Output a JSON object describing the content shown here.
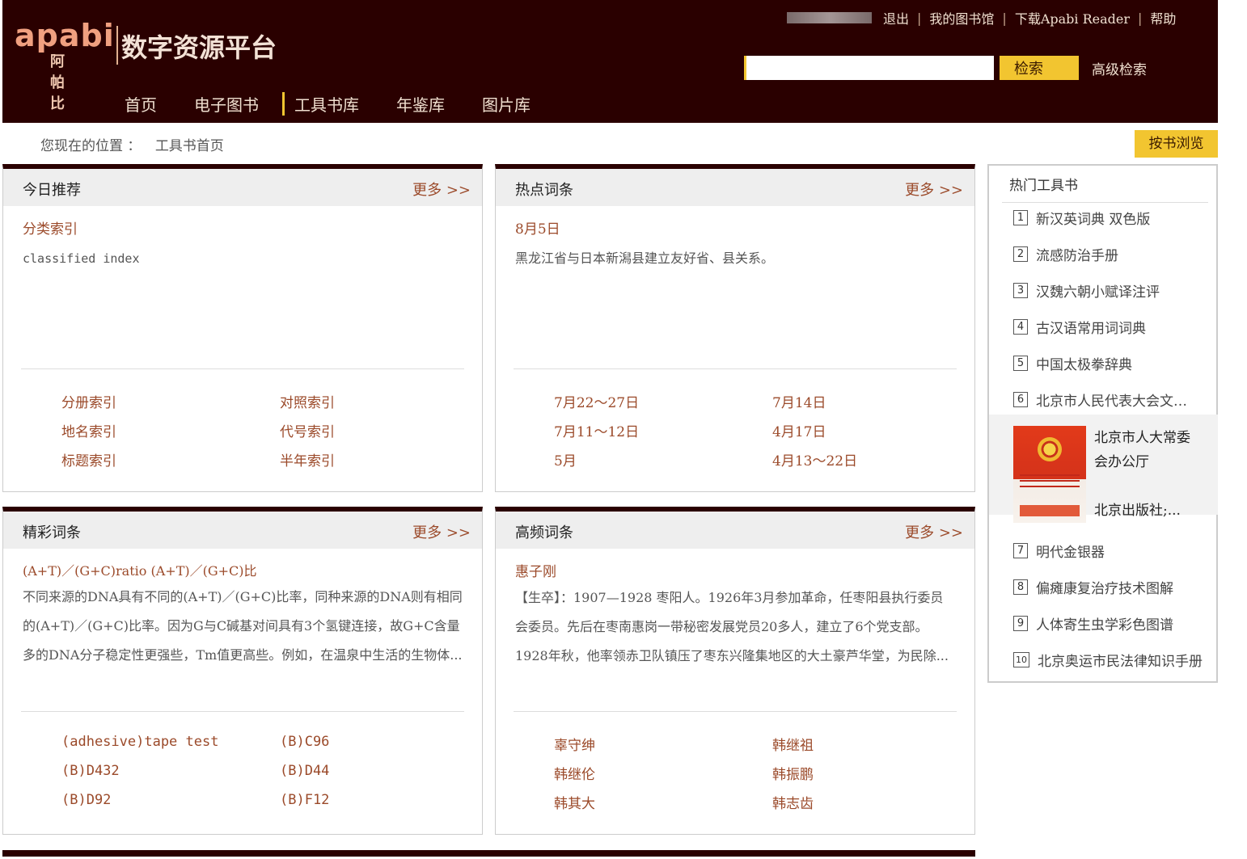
{
  "header": {
    "logo_en": "apabi",
    "logo_cn": "阿帕比",
    "platform_title": "数字资源平台",
    "links": [
      "退出",
      "我的图书馆",
      "下载Apabi Reader",
      "帮助"
    ],
    "search_placeholder": "",
    "search_button": "检索",
    "advanced_search": "高级检索",
    "nav": [
      {
        "label": "首页"
      },
      {
        "label": "电子图书"
      },
      {
        "label": "工具书库",
        "active": true
      },
      {
        "label": "年鉴库"
      },
      {
        "label": "图片库"
      }
    ]
  },
  "breadcrumb": {
    "prefix": "您现在的位置 ：",
    "current": "工具书首页"
  },
  "browse_button": "按书浏览",
  "panels": {
    "today": {
      "title": "今日推荐",
      "more": "更多 >>",
      "entry_title": "分类索引",
      "entry_text": "classified index",
      "links": [
        "分册索引",
        "对照索引",
        "地名索引",
        "代号索引",
        "标题索引",
        "半年索引"
      ]
    },
    "hot": {
      "title": "热点词条",
      "more": "更多 >>",
      "entry_title": "8月5日",
      "entry_text": "黑龙江省与日本新潟县建立友好省、县关系。",
      "links": [
        "7月22～27日",
        "7月14日",
        "7月11～12日",
        "4月17日",
        "5月",
        "4月13～22日"
      ]
    },
    "featured": {
      "title": "精彩词条",
      "more": "更多 >>",
      "entry_title": "(A+T)／(G+C)ratio (A+T)／(G+C)比",
      "entry_text": "不同来源的DNA具有不同的(A+T)／(G+C)比率，同种来源的DNA则有相同的(A+T)／(G+C)比率。因为G与C碱基对间具有3个氢键连接，故G+C含量多的DNA分子稳定性更强些，Tm值更高些。例如，在温泉中生活的生物体...",
      "links": [
        "(adhesive)tape test",
        "(B)C96",
        "(B)D432",
        "(B)D44",
        "(B)D92",
        "(B)F12"
      ]
    },
    "frequent": {
      "title": "高频词条",
      "more": "更多 >>",
      "entry_title": "惠子刚",
      "entry_text": "【生卒】：1907—1928 枣阳人。1926年3月参加革命，任枣阳县执行委员会委员。先后在枣南惠岗一带秘密发展党员20多人，建立了6个党支部。1928年秋，他率领赤卫队镇压了枣东兴隆集地区的大土豪芦华堂，为民除...",
      "links": [
        "辜守绅",
        "韩继祖",
        "韩继伦",
        "韩振鹏",
        "韩其大",
        "韩志齿"
      ]
    }
  },
  "sidebar": {
    "title": "热门工具书",
    "items": [
      {
        "num": "1",
        "label": "新汉英词典 双色版"
      },
      {
        "num": "2",
        "label": "流感防治手册"
      },
      {
        "num": "3",
        "label": "汉魏六朝小赋译注评"
      },
      {
        "num": "4",
        "label": "古汉语常用词词典"
      },
      {
        "num": "5",
        "label": "中国太极拳辞典"
      },
      {
        "num": "6",
        "label": "北京市人民代表大会文…"
      },
      {
        "num": "7",
        "label": "明代金银器"
      },
      {
        "num": "8",
        "label": "偏瘫康复治疗技术图解"
      },
      {
        "num": "9",
        "label": "人体寄生虫学彩色图谱"
      },
      {
        "num": "10",
        "label": "北京奥运市民法律知识手册"
      }
    ],
    "feature": {
      "title": "北京市人大常委会办公厅",
      "publisher": "北京出版社;..."
    }
  },
  "colors": {
    "header_bg": "#2a0000",
    "accent": "#f2c530",
    "link": "#9b4a2a"
  }
}
